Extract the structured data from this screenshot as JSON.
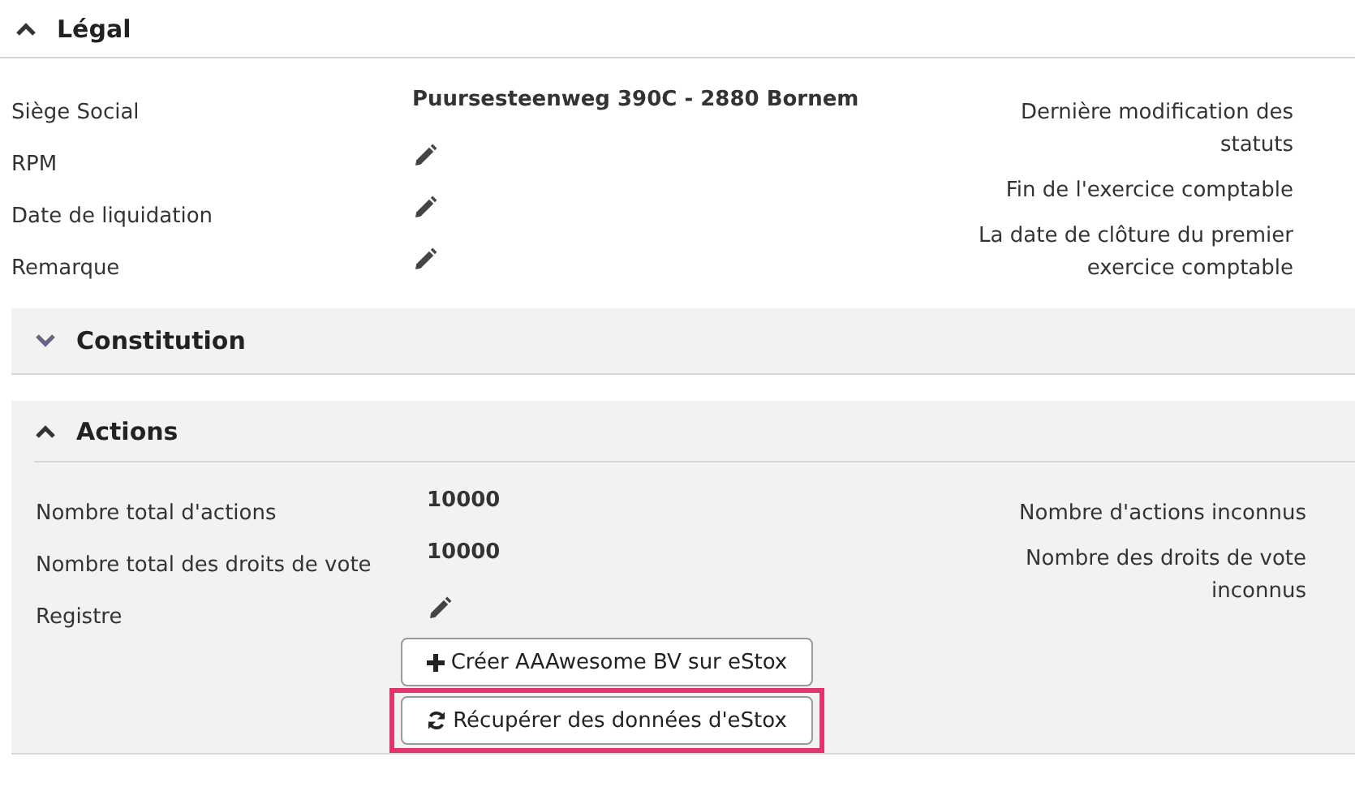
{
  "sections": [
    {
      "title": "Légal",
      "kind": "plain",
      "expanded": true,
      "fields": [
        {
          "label": "Siège Social",
          "kind": "text",
          "value": "Puursesteenweg 390C - 2880 Bornem"
        },
        {
          "label": "RPM",
          "kind": "edit"
        },
        {
          "label": "Date de liquidation",
          "kind": "edit"
        },
        {
          "label": "Remarque",
          "kind": "edit"
        }
      ],
      "side_labels": [
        "Dernière modification des statuts",
        "Fin de l'exercice comptable",
        "La date de clôture du premier exercice comptable"
      ]
    },
    {
      "title": "Constitution",
      "kind": "panel",
      "expanded": false
    },
    {
      "title": "Actions",
      "kind": "panel",
      "expanded": true,
      "fields": [
        {
          "label": "Nombre total d'actions",
          "kind": "text",
          "value": "10000"
        },
        {
          "label": "Nombre total des droits de vote",
          "kind": "text",
          "value": "10000"
        },
        {
          "label": "Registre",
          "kind": "edit"
        }
      ],
      "side_labels": [
        "Nombre d'actions inconnus",
        "Nombre des droits de vote inconnus"
      ],
      "buttons": [
        {
          "label": "Créer AAAwesome BV sur eStox",
          "kind": "plus",
          "highlighted": false
        },
        {
          "label": "Récupérer des données d'eStox",
          "kind": "refresh",
          "highlighted": true
        }
      ]
    }
  ]
}
